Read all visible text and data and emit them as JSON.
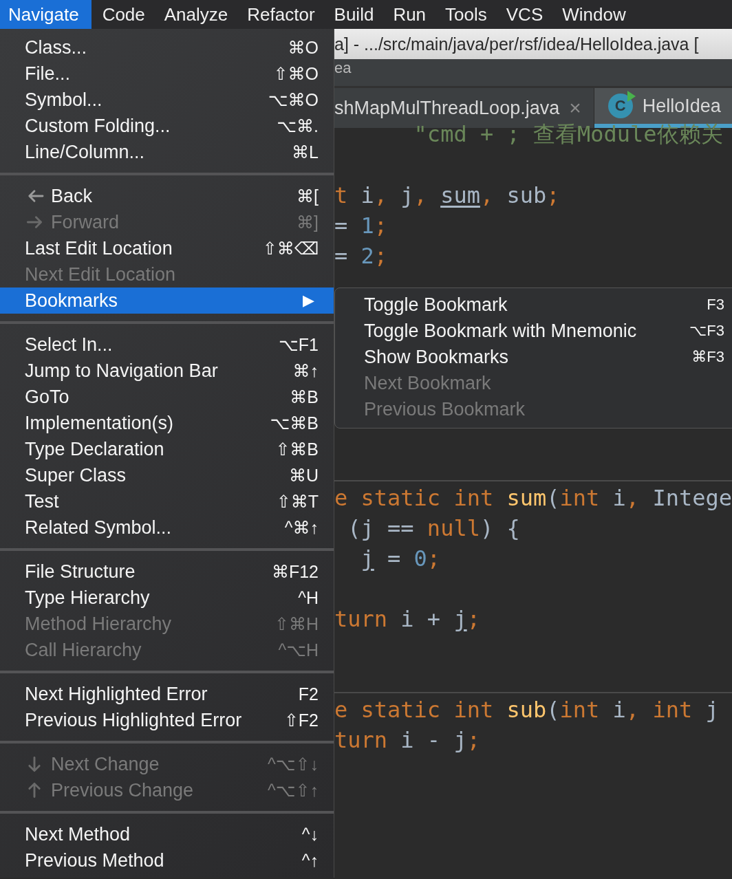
{
  "menu_bar": [
    {
      "label": "Navigate",
      "selected": true
    },
    {
      "label": "Code",
      "selected": false
    },
    {
      "label": "Analyze",
      "selected": false
    },
    {
      "label": "Refactor",
      "selected": false
    },
    {
      "label": "Build",
      "selected": false
    },
    {
      "label": "Run",
      "selected": false
    },
    {
      "label": "Tools",
      "selected": false
    },
    {
      "label": "VCS",
      "selected": false
    },
    {
      "label": "Window",
      "selected": false
    }
  ],
  "window": {
    "title": "a] - .../src/main/java/per/rsf/idea/HelloIdea.java ["
  },
  "navigation_bar": {
    "text": "ea"
  },
  "editor_tabs": [
    {
      "label": "shMapMulThreadLoop.java",
      "close": "×",
      "selected": false
    },
    {
      "label": "HelloIdea",
      "icon_text": "C",
      "selected": true
    }
  ],
  "code_lines": [
    {
      "tokens": [
        {
          "text": "      \"cmd + ; 查看Module依赖关",
          "kind": "string"
        }
      ]
    },
    {
      "tokens": [
        {
          "text": "t",
          "kind": "keyword"
        },
        {
          "text": " i",
          "kind": "plain"
        },
        {
          "text": ",",
          "kind": "keyword"
        },
        {
          "text": " j",
          "kind": "plain"
        },
        {
          "text": ",",
          "kind": "keyword"
        },
        {
          "text": " sum",
          "kind": "plain",
          "underlined": true
        },
        {
          "text": ",",
          "kind": "keyword"
        },
        {
          "text": " sub",
          "kind": "plain"
        },
        {
          "text": ";",
          "kind": "keyword"
        }
      ]
    },
    {
      "tokens": [
        {
          "text": "= ",
          "kind": "plain"
        },
        {
          "text": "1",
          "kind": "number"
        },
        {
          "text": ";",
          "kind": "keyword"
        }
      ]
    },
    {
      "tokens": [
        {
          "text": "= ",
          "kind": "plain"
        },
        {
          "text": "2",
          "kind": "number"
        },
        {
          "text": ";",
          "kind": "keyword"
        }
      ]
    },
    {
      "tokens": [
        {
          "text": "e static int ",
          "kind": "keyword"
        },
        {
          "text": "sum",
          "kind": "method"
        },
        {
          "text": "(",
          "kind": "plain"
        },
        {
          "text": "int ",
          "kind": "keyword"
        },
        {
          "text": "i",
          "kind": "plain"
        },
        {
          "text": ", ",
          "kind": "keyword"
        },
        {
          "text": "Intege",
          "kind": "plain"
        }
      ]
    },
    {
      "tokens": [
        {
          "text": " (j == ",
          "kind": "plain"
        },
        {
          "text": "null",
          "kind": "keyword"
        },
        {
          "text": ") {",
          "kind": "plain"
        }
      ]
    },
    {
      "tokens": [
        {
          "text": "  j",
          "kind": "plain",
          "underlined": true
        },
        {
          "text": " = ",
          "kind": "plain"
        },
        {
          "text": "0",
          "kind": "number"
        },
        {
          "text": ";",
          "kind": "keyword"
        }
      ]
    },
    {
      "tokens": [
        {
          "text": "turn ",
          "kind": "keyword"
        },
        {
          "text": "i + ",
          "kind": "plain"
        },
        {
          "text": "j",
          "kind": "plain",
          "underlined": true
        },
        {
          "text": ";",
          "kind": "keyword"
        }
      ]
    },
    {
      "tokens": [
        {
          "text": "e static int ",
          "kind": "keyword"
        },
        {
          "text": "sub",
          "kind": "method"
        },
        {
          "text": "(",
          "kind": "plain"
        },
        {
          "text": "int ",
          "kind": "keyword"
        },
        {
          "text": "i",
          "kind": "plain"
        },
        {
          "text": ", ",
          "kind": "keyword"
        },
        {
          "text": "int ",
          "kind": "keyword"
        },
        {
          "text": "j",
          "kind": "plain"
        }
      ]
    },
    {
      "tokens": [
        {
          "text": "turn ",
          "kind": "keyword"
        },
        {
          "text": "i - j",
          "kind": "plain"
        },
        {
          "text": ";",
          "kind": "keyword"
        }
      ]
    }
  ],
  "navigate_menu": [
    {
      "kind": "item",
      "label": "Class...",
      "shortcut": "⌘O",
      "disabled": false,
      "selected": false
    },
    {
      "kind": "item",
      "label": "File...",
      "shortcut": "⇧⌘O",
      "disabled": false,
      "selected": false
    },
    {
      "kind": "item",
      "label": "Symbol...",
      "shortcut": "⌥⌘O",
      "disabled": false,
      "selected": false
    },
    {
      "kind": "item",
      "label": "Custom Folding...",
      "shortcut": "⌥⌘.",
      "disabled": false,
      "selected": false
    },
    {
      "kind": "item",
      "label": "Line/Column...",
      "shortcut": "⌘L",
      "disabled": false,
      "selected": false
    },
    {
      "kind": "separator"
    },
    {
      "kind": "back",
      "label": "Back",
      "shortcut": "⌘[",
      "disabled": false,
      "selected": false
    },
    {
      "kind": "forward",
      "label": "Forward",
      "shortcut": "⌘]",
      "disabled": true,
      "selected": false
    },
    {
      "kind": "item",
      "label": "Last Edit Location",
      "shortcut": "⇧⌘⌫",
      "disabled": false,
      "selected": false
    },
    {
      "kind": "item",
      "label": "Next Edit Location",
      "disabled": true,
      "selected": false
    },
    {
      "kind": "item",
      "label": "Bookmarks",
      "submenu_arrow": "▶",
      "disabled": false,
      "selected": true
    },
    {
      "kind": "separator"
    },
    {
      "kind": "item",
      "label": "Select In...",
      "shortcut": "⌥F1",
      "disabled": false,
      "selected": false
    },
    {
      "kind": "item",
      "label": "Jump to Navigation Bar",
      "shortcut": "⌘↑",
      "disabled": false,
      "selected": false
    },
    {
      "kind": "item",
      "label": "GoTo",
      "shortcut": "⌘B",
      "disabled": false,
      "selected": false
    },
    {
      "kind": "item",
      "label": "Implementation(s)",
      "shortcut": "⌥⌘B",
      "disabled": false,
      "selected": false
    },
    {
      "kind": "item",
      "label": "Type Declaration",
      "shortcut": "⇧⌘B",
      "disabled": false,
      "selected": false
    },
    {
      "kind": "item",
      "label": "Super Class",
      "shortcut": "⌘U",
      "disabled": false,
      "selected": false
    },
    {
      "kind": "item",
      "label": "Test",
      "shortcut": "⇧⌘T",
      "disabled": false,
      "selected": false
    },
    {
      "kind": "item",
      "label": "Related Symbol...",
      "shortcut": "^⌘↑",
      "disabled": false,
      "selected": false
    },
    {
      "kind": "separator"
    },
    {
      "kind": "item",
      "label": "File Structure",
      "shortcut": "⌘F12",
      "disabled": false,
      "selected": false
    },
    {
      "kind": "item",
      "label": "Type Hierarchy",
      "shortcut": "^H",
      "disabled": false,
      "selected": false
    },
    {
      "kind": "item",
      "label": "Method Hierarchy",
      "shortcut": "⇧⌘H",
      "disabled": true,
      "selected": false
    },
    {
      "kind": "item",
      "label": "Call Hierarchy",
      "shortcut": "^⌥H",
      "disabled": true,
      "selected": false
    },
    {
      "kind": "separator"
    },
    {
      "kind": "item",
      "label": "Next Highlighted Error",
      "shortcut": "F2",
      "disabled": false,
      "selected": false
    },
    {
      "kind": "item",
      "label": "Previous Highlighted Error",
      "shortcut": "⇧F2",
      "disabled": false,
      "selected": false
    },
    {
      "kind": "separator"
    },
    {
      "kind": "down",
      "label": "Next Change",
      "shortcut": "^⌥⇧↓",
      "disabled": true,
      "selected": false
    },
    {
      "kind": "up",
      "label": "Previous Change",
      "shortcut": "^⌥⇧↑",
      "disabled": true,
      "selected": false
    },
    {
      "kind": "separator"
    },
    {
      "kind": "item",
      "label": "Next Method",
      "shortcut": "^↓",
      "disabled": false,
      "selected": false
    },
    {
      "kind": "item",
      "label": "Previous Method",
      "shortcut": "^↑",
      "disabled": false,
      "selected": false
    }
  ],
  "bookmarks_submenu": [
    {
      "label": "Toggle Bookmark",
      "shortcut": "F3",
      "disabled": false
    },
    {
      "label": "Toggle Bookmark with Mnemonic",
      "shortcut": "⌥F3",
      "disabled": false
    },
    {
      "label": "Show Bookmarks",
      "shortcut": "⌘F3",
      "disabled": false
    },
    {
      "label": "Next Bookmark",
      "disabled": true
    },
    {
      "label": "Previous Bookmark",
      "disabled": true
    }
  ]
}
